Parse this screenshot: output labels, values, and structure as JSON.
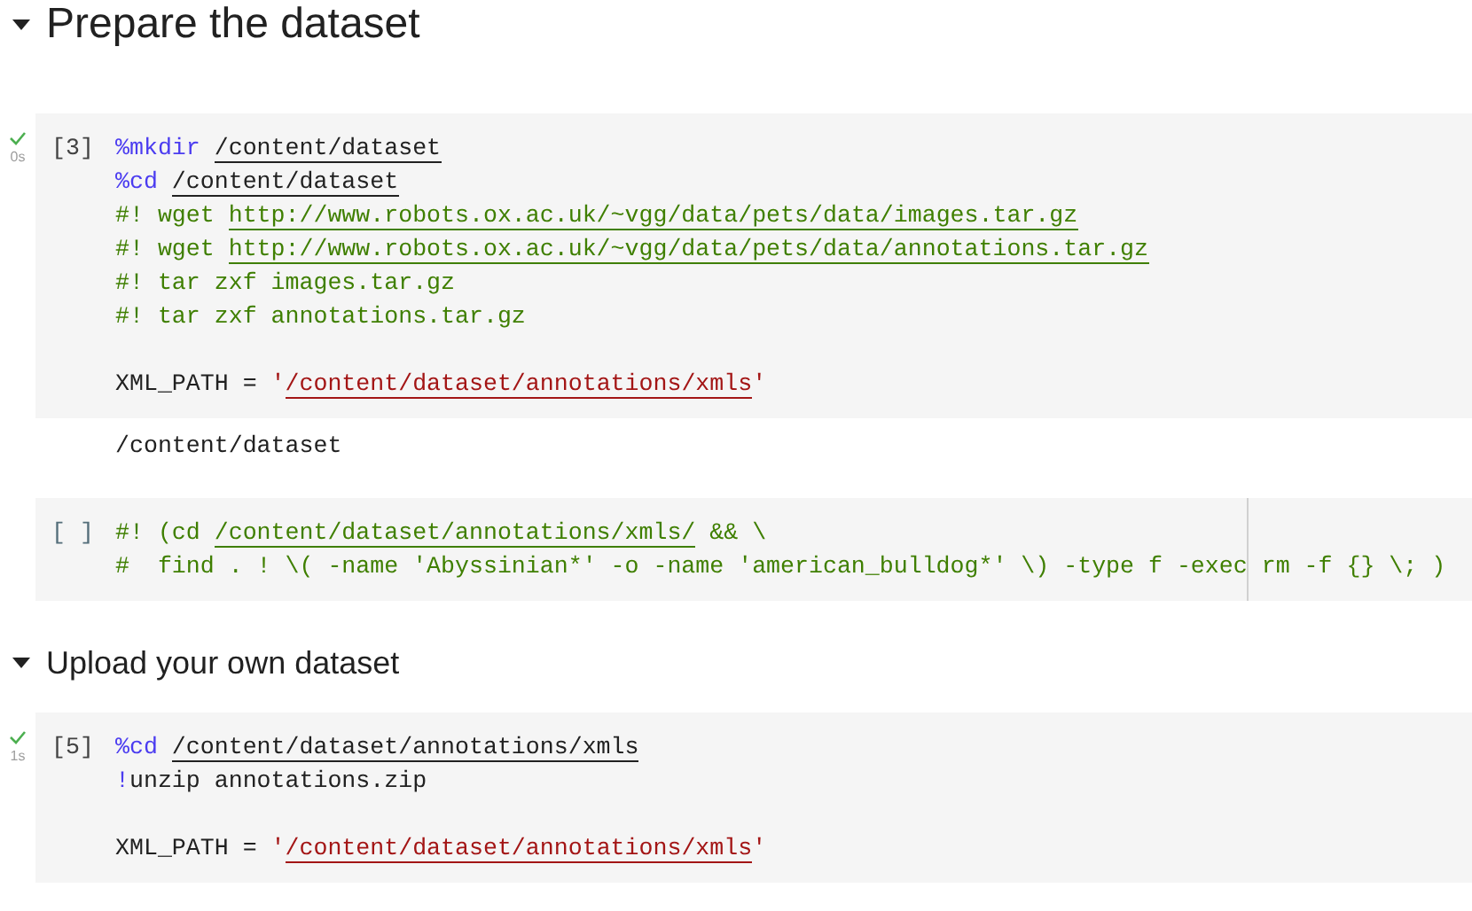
{
  "sections": [
    {
      "title": "Prepare the dataset",
      "kind": "h1",
      "expanded": true,
      "cells": [
        {
          "prompt": "[3]",
          "ran": true,
          "duration": "0s",
          "ruler": false,
          "lines": [
            {
              "kind": "code",
              "tokens": [
                {
                  "kind": "magic",
                  "text": "%mkdir "
                },
                {
                  "kind": "path",
                  "text": "/content/dataset",
                  "link": true
                }
              ]
            },
            {
              "kind": "code",
              "tokens": [
                {
                  "kind": "magic",
                  "text": "%cd "
                },
                {
                  "kind": "path",
                  "text": "/content/dataset",
                  "link": true
                }
              ]
            },
            {
              "kind": "code",
              "tokens": [
                {
                  "kind": "comment",
                  "text": "#! wget "
                },
                {
                  "kind": "comment",
                  "text": "http://www.robots.ox.ac.uk/~vgg/data/pets/data/images.tar.gz",
                  "link": true
                }
              ]
            },
            {
              "kind": "code",
              "tokens": [
                {
                  "kind": "comment",
                  "text": "#! wget "
                },
                {
                  "kind": "comment",
                  "text": "http://www.robots.ox.ac.uk/~vgg/data/pets/data/annotations.tar.gz",
                  "link": true
                }
              ]
            },
            {
              "kind": "code",
              "tokens": [
                {
                  "kind": "comment",
                  "text": "#! tar zxf images.tar.gz"
                }
              ]
            },
            {
              "kind": "code",
              "tokens": [
                {
                  "kind": "comment",
                  "text": "#! tar zxf annotations.tar.gz"
                }
              ]
            },
            {
              "kind": "blank"
            },
            {
              "kind": "code",
              "tokens": [
                {
                  "kind": "path",
                  "text": "XML_PATH = "
                },
                {
                  "kind": "string",
                  "text": "'"
                },
                {
                  "kind": "string",
                  "text": "/content/dataset/annotations/xmls",
                  "link": true
                },
                {
                  "kind": "string",
                  "text": "'"
                }
              ]
            }
          ],
          "output": [
            "/content/dataset"
          ]
        },
        {
          "prompt": "[ ]",
          "ran": false,
          "ruler": true,
          "lines": [
            {
              "kind": "code",
              "tokens": [
                {
                  "kind": "comment",
                  "text": "#! (cd "
                },
                {
                  "kind": "comment",
                  "text": "/content/dataset/annotations/xmls/",
                  "link": true
                },
                {
                  "kind": "comment",
                  "text": " && \\"
                }
              ]
            },
            {
              "kind": "code",
              "tokens": [
                {
                  "kind": "comment",
                  "text": "#  find . ! \\( -name 'Abyssinian*' -o -name 'american_bulldog*' \\) -type f -exec rm -f {} \\; )"
                }
              ]
            }
          ]
        }
      ]
    },
    {
      "title": "Upload your own dataset",
      "kind": "h2",
      "expanded": true,
      "cells": [
        {
          "prompt": "[5]",
          "ran": true,
          "duration": "1s",
          "ruler": false,
          "lines": [
            {
              "kind": "code",
              "tokens": [
                {
                  "kind": "magic",
                  "text": "%cd "
                },
                {
                  "kind": "path",
                  "text": "/content/dataset/annotations/xmls",
                  "link": true
                }
              ]
            },
            {
              "kind": "code",
              "tokens": [
                {
                  "kind": "magic",
                  "text": "!"
                },
                {
                  "kind": "path",
                  "text": "unzip annotations.zip"
                }
              ]
            },
            {
              "kind": "blank"
            },
            {
              "kind": "code",
              "tokens": [
                {
                  "kind": "path",
                  "text": "XML_PATH = "
                },
                {
                  "kind": "string",
                  "text": "'"
                },
                {
                  "kind": "string",
                  "text": "/content/dataset/annotations/xmls",
                  "link": true
                },
                {
                  "kind": "string",
                  "text": "'"
                }
              ]
            }
          ]
        }
      ]
    }
  ]
}
